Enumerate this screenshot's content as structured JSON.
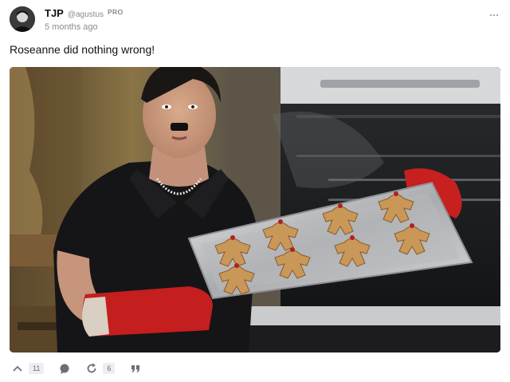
{
  "post": {
    "author_name": "TJP",
    "author_handle": "@agustus",
    "badge": "PRO",
    "timestamp": "5 months ago",
    "text": "Roseanne did nothing wrong!"
  },
  "image": {
    "description_icon": "photo"
  },
  "actions": {
    "upvote_count": "11",
    "share_count": "6"
  },
  "icons": {
    "more": "more-dots-icon",
    "upvote": "chevron-up-icon",
    "comment": "comment-bubble-icon",
    "share": "repost-icon",
    "quote": "quote-icon"
  },
  "colors": {
    "muted": "#8a8a8a",
    "count_bg": "#eeeeee",
    "icon": "#6f6f6f"
  }
}
